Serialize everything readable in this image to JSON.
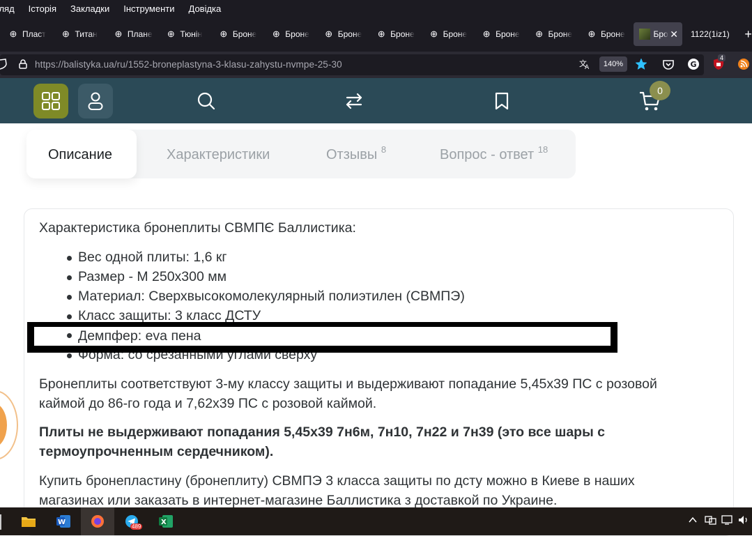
{
  "browser": {
    "menu": [
      "гляд",
      "Історія",
      "Закладки",
      "Інструменти",
      "Довідка"
    ],
    "tabs": [
      {
        "label": "Пласт"
      },
      {
        "label": "Титан"
      },
      {
        "label": "Плане"
      },
      {
        "label": "Тюнін"
      },
      {
        "label": "Броне"
      },
      {
        "label": "Броне"
      },
      {
        "label": "Броне"
      },
      {
        "label": "Броне"
      },
      {
        "label": "Броне"
      },
      {
        "label": "Броне"
      },
      {
        "label": "Броне"
      },
      {
        "label": "Броне"
      }
    ],
    "active_tab": {
      "label": "Бро"
    },
    "extra_tab": {
      "label": "1122(1iz1)"
    },
    "new_tab": "+",
    "url_host": "https://balistyka.ua",
    "url_path": "/ru/1552-broneplastyna-3-klasu-zahystu-nvmpe-25-30",
    "zoom": "140%",
    "ext_badge": "4"
  },
  "site": {
    "cart_count": "0"
  },
  "product_tabs": [
    {
      "label": "Описание",
      "count": ""
    },
    {
      "label": "Характеристики",
      "count": ""
    },
    {
      "label": "Отзывы",
      "count": "8"
    },
    {
      "label": "Вопрос - ответ",
      "count": "18"
    }
  ],
  "content": {
    "heading": "Характеристика бронеплиты СВМПЄ Баллистика:",
    "specs": [
      "Вес одной плиты: 1,6 кг",
      "Размер - М 250х300 мм",
      "Материал: Сверхвысокомолекулярный полиэтилен (СВМПЭ)",
      "Класс защиты: 3 класс ДСТУ",
      "Демпфер: eva пена",
      "Форма: со срезанными углами сверху"
    ],
    "para1_line1": "Бронеплиты соответствуют 3-му классу защиты и выдерживают попадание 5,45х39 ПС с розовой",
    "para1_line2": "каймой до 86-го года и 7,62х39 ПС с розовой каймой.",
    "para2_line1": "Плиты не выдерживают попадания 5,45х39 7н6м, 7н10, 7н22 и 7н39 (это все шары с",
    "para2_line2": "термоупрочненным сердечником).",
    "para3_line1": "Купить бронепластину (бронеплиту) СВМПЭ 3 класса защиты по дсту можно в Киеве в наших",
    "para3_line2": "магазинах или заказать в интернет-магазине Баллистика з доставкой по Украине."
  },
  "taskbar": {
    "telegram_badge": "489"
  }
}
